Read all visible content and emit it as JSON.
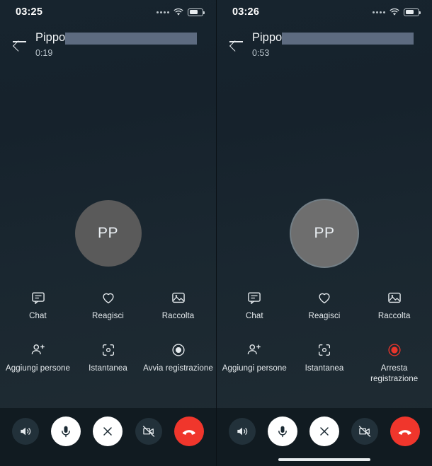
{
  "screens": [
    {
      "id": "left",
      "status": {
        "time": "03:25",
        "signal_dots": 4,
        "wifi": "wifi-icon",
        "battery_level": 55
      },
      "header": {
        "contact_name": "Pippo",
        "name_redacted": true,
        "call_timer": "0:19",
        "back": "back-arrow-icon"
      },
      "avatar": {
        "initials": "PP",
        "ringed": false
      },
      "actions": [
        {
          "icon": "chat-icon",
          "label": "Chat"
        },
        {
          "icon": "heart-icon",
          "label": "Reagisci"
        },
        {
          "icon": "gallery-icon",
          "label": "Raccolta"
        },
        {
          "icon": "add-person-icon",
          "label": "Aggiungi persone"
        },
        {
          "icon": "snapshot-icon",
          "label": "Istantanea"
        },
        {
          "icon": "record-start-icon",
          "label": "Avvia registrazione"
        }
      ],
      "controls": [
        {
          "icon": "speaker-icon",
          "style": "dark"
        },
        {
          "icon": "microphone-icon",
          "style": "light"
        },
        {
          "icon": "close-icon",
          "style": "light"
        },
        {
          "icon": "video-off-icon",
          "style": "dark"
        },
        {
          "icon": "hangup-icon",
          "style": "red"
        }
      ],
      "home_indicator": false
    },
    {
      "id": "right",
      "status": {
        "time": "03:26",
        "signal_dots": 4,
        "wifi": "wifi-icon",
        "battery_level": 55
      },
      "header": {
        "contact_name": "Pippo",
        "name_redacted": true,
        "call_timer": "0:53",
        "back": "back-arrow-icon"
      },
      "avatar": {
        "initials": "PP",
        "ringed": true
      },
      "actions": [
        {
          "icon": "chat-icon",
          "label": "Chat"
        },
        {
          "icon": "heart-icon",
          "label": "Reagisci"
        },
        {
          "icon": "gallery-icon",
          "label": "Raccolta"
        },
        {
          "icon": "add-person-icon",
          "label": "Aggiungi persone"
        },
        {
          "icon": "snapshot-icon",
          "label": "Istantanea"
        },
        {
          "icon": "record-stop-icon",
          "label": "Arresta registrazione"
        }
      ],
      "controls": [
        {
          "icon": "speaker-icon",
          "style": "dark"
        },
        {
          "icon": "microphone-icon",
          "style": "light"
        },
        {
          "icon": "close-icon",
          "style": "light"
        },
        {
          "icon": "video-off-icon",
          "style": "dark"
        },
        {
          "icon": "hangup-icon",
          "style": "red"
        }
      ],
      "home_indicator": true
    }
  ],
  "colors": {
    "background": "#17242e",
    "bottom_bar": "#111b21",
    "accent_red": "#f0362c",
    "record_red": "#e8352b",
    "redaction": "#5d6b80",
    "text_primary": "#f2f5f7",
    "text_secondary": "#b8c3ca"
  }
}
